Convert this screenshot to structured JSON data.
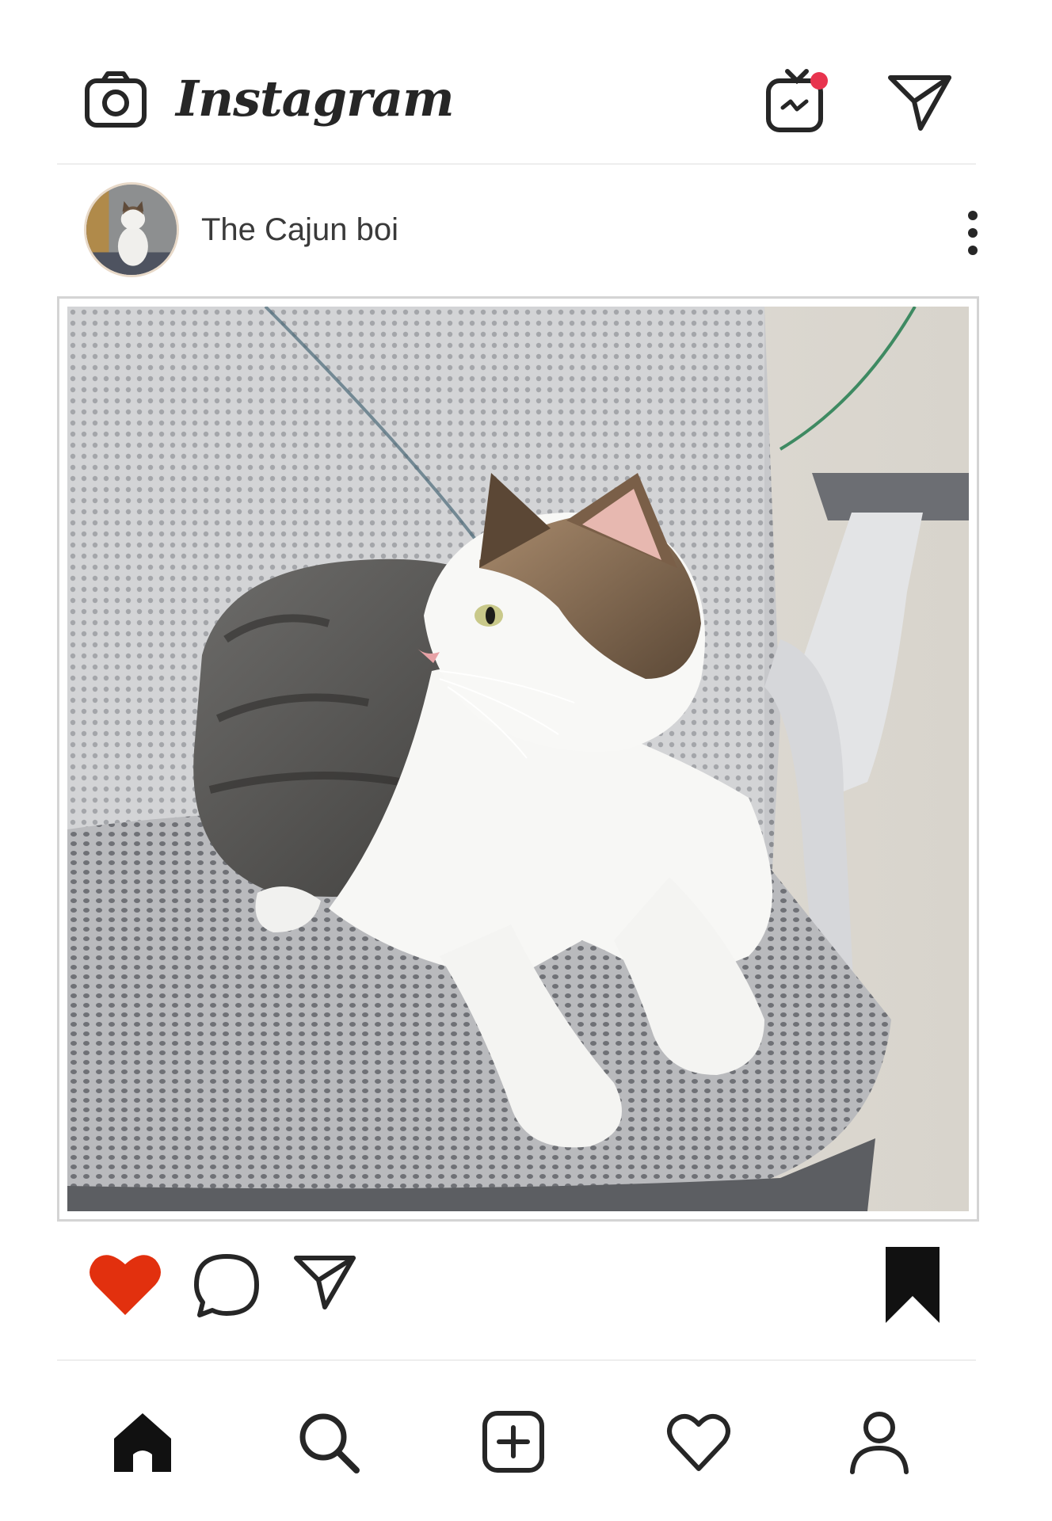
{
  "app": {
    "name": "Instagram"
  },
  "header": {
    "brand_text": "Instagram",
    "icons": [
      "camera-icon",
      "igtv-icon",
      "direct-message-icon"
    ],
    "notification_dot_color": "#e8344e"
  },
  "post": {
    "username": "The Cajun boi",
    "avatar_alt": "avatar",
    "liked": true,
    "saved": true,
    "like_color": "#e2300e"
  },
  "actions": [
    "heart-icon",
    "comment-icon",
    "share-icon",
    "bookmark-icon"
  ],
  "bottom_nav": [
    "home-icon",
    "search-icon",
    "new-post-icon",
    "activity-icon",
    "profile-icon"
  ],
  "colors": {
    "text": "#262626",
    "divider": "#eeeeee"
  }
}
